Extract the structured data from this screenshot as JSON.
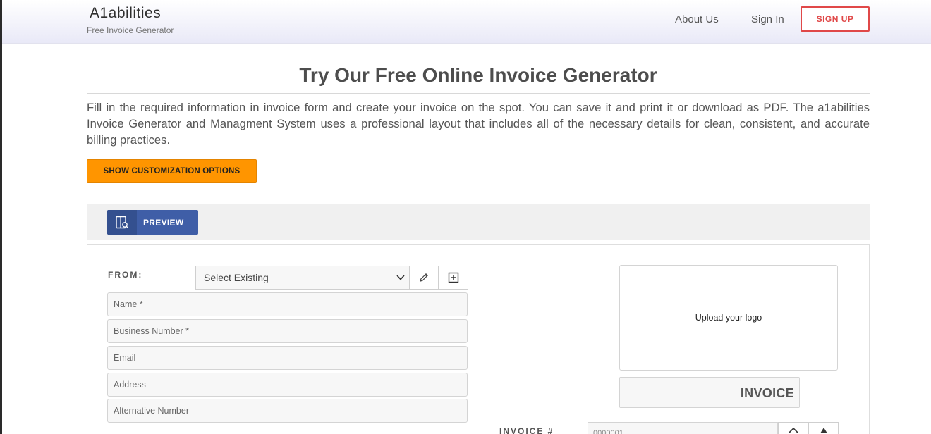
{
  "header": {
    "brand": "A1abilities",
    "tagline": "Free Invoice Generator",
    "nav": {
      "about": "About Us",
      "signin": "Sign In",
      "signup": "SIGN UP"
    }
  },
  "page": {
    "title": "Try Our Free Online Invoice Generator",
    "intro": "Fill in the required information in invoice form and create your invoice on the spot. You can save it and print it or download as PDF. The a1abilities Invoice Generator and Managment System uses a professional layout that includes all of the necessary details for clean, consistent, and accurate billing practices.",
    "customize_label": "SHOW CUSTOMIZATION OPTIONS"
  },
  "toolbar": {
    "preview_label": "PREVIEW"
  },
  "form": {
    "from_label": "FROM:",
    "select_existing": "Select Existing",
    "fields": {
      "name": "Name *",
      "business_number": "Business Number *",
      "email": "Email",
      "address": "Address",
      "alt_number": "Alternative Number"
    },
    "logo_upload": "Upload your logo",
    "invoice_title": "INVOICE",
    "invoice_number_label": "INVOICE #",
    "invoice_number_value": "0000001"
  },
  "icons": {
    "preview": "preview-icon",
    "edit": "pencil-icon",
    "add": "plus-box-icon",
    "select": "chevron-down-icon",
    "up": "chevron-up-icon",
    "arrow": "arrow-up-icon"
  },
  "colors": {
    "accent_orange": "#ff9500",
    "signup_red": "#e04848",
    "preview_blue": "#3f5ea7"
  }
}
